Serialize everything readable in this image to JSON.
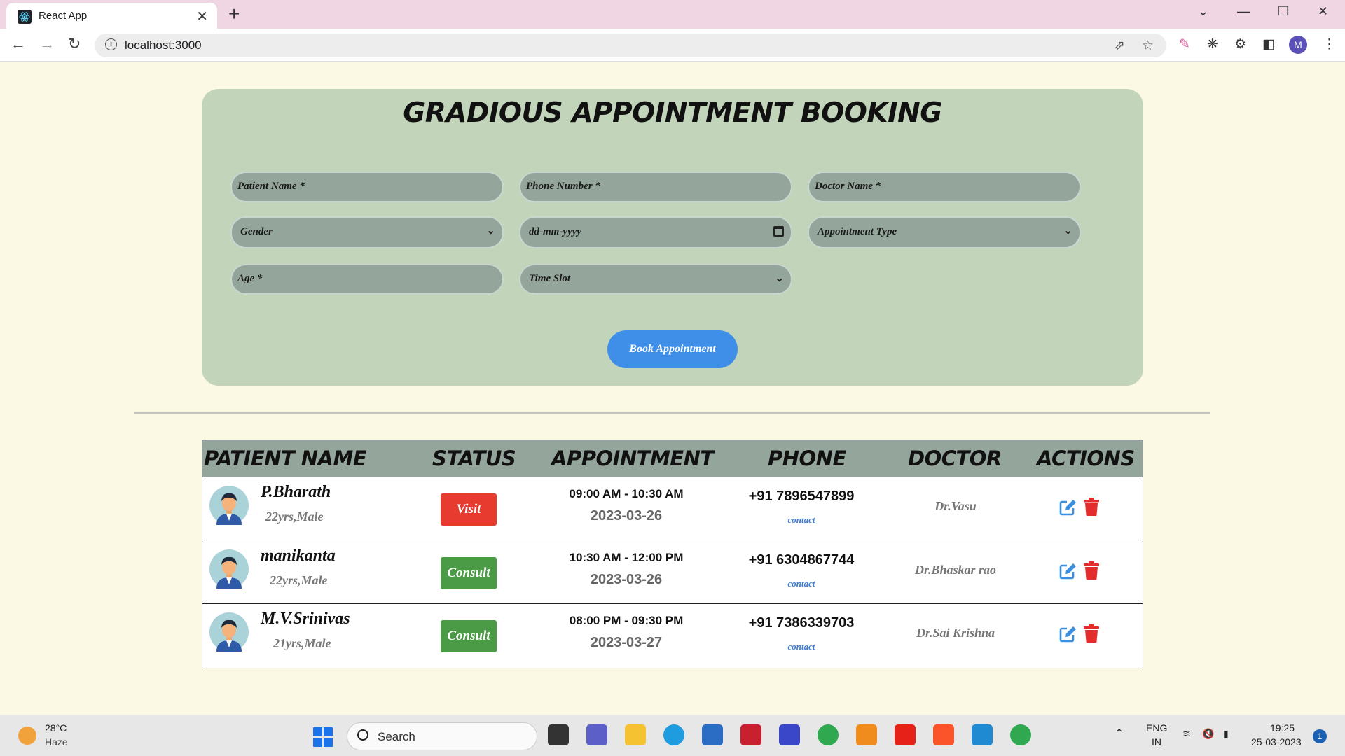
{
  "browser": {
    "tab_title": "React App",
    "tab_close": "✕",
    "new_tab": "+",
    "url": "localhost:3000",
    "controls": {
      "minimize": "—",
      "restore": "❐",
      "close": "✕",
      "tab_search": "⌄"
    },
    "profile_initial": "M"
  },
  "app": {
    "title": "GRADIOUS APPOINTMENT BOOKING",
    "form": {
      "patient_name_placeholder": "Patient Name *",
      "phone_placeholder": "Phone Number *",
      "doctor_placeholder": "Doctor Name *",
      "gender_selected": "Gender",
      "date_placeholder": "dd-mm-yyyy",
      "appointment_type_selected": "Appointment Type",
      "age_placeholder": "Age *",
      "time_slot_selected": "Time Slot",
      "book_button": "Book Appointment"
    },
    "table": {
      "headers": [
        "PATIENT NAME",
        "STATUS",
        "APPOINTMENT",
        "PHONE",
        "DOCTOR",
        "ACTIONS"
      ],
      "rows": [
        {
          "name": "P.Bharath",
          "meta": "22yrs,Male",
          "status": "Visit",
          "status_color": "#e63b2e",
          "time": "09:00 AM - 10:30 AM",
          "date": "2023-03-26",
          "phone": "+91 7896547899",
          "contact": "contact",
          "doctor": "Dr.Vasu"
        },
        {
          "name": "manikanta",
          "meta": "22yrs,Male",
          "status": "Consult",
          "status_color": "#4a9a46",
          "time": "10:30 AM - 12:00 PM",
          "date": "2023-03-26",
          "phone": "+91 6304867744",
          "contact": "contact",
          "doctor": "Dr.Bhaskar rao"
        },
        {
          "name": "M.V.Srinivas",
          "meta": "21yrs,Male",
          "status": "Consult",
          "status_color": "#4a9a46",
          "time": "08:00 PM - 09:30 PM",
          "date": "2023-03-27",
          "phone": "+91 7386339703",
          "contact": "contact",
          "doctor": "Dr.Sai Krishna"
        }
      ]
    }
  },
  "taskbar": {
    "weather_temp": "28°C",
    "weather_desc": "Haze",
    "search_label": "Search",
    "lang_top": "ENG",
    "lang_bottom": "IN",
    "time": "19:25",
    "date": "25-03-2023",
    "notification_count": "1"
  }
}
